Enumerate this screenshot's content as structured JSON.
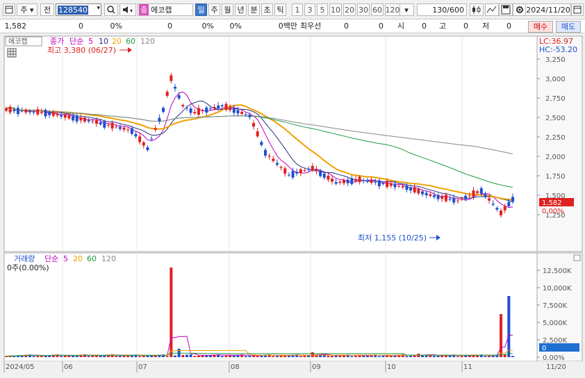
{
  "toolbar": {
    "market_label": "주",
    "prev_label": "전",
    "stock_code": "128540",
    "stock_name": "에코캡",
    "stock_badge": "종",
    "period_tabs": [
      "일",
      "주",
      "월",
      "년",
      "분",
      "초",
      "틱"
    ],
    "selected_period": "일",
    "interval_tabs": [
      "1",
      "3",
      "5",
      "10",
      "20",
      "30",
      "60",
      "120"
    ],
    "count": "130",
    "count_total": "/600",
    "date": "2024/11/20"
  },
  "infobar": {
    "price": "1,582",
    "change": "0",
    "change_pct": "0%",
    "volume": "0",
    "volume_pct": "0%",
    "vol_rate": "0%",
    "amount": "0백만",
    "priority_label": "최우선",
    "priority_value": "0",
    "priority_value2": "0",
    "open_label": "시",
    "open_value": "0",
    "high_label": "고",
    "high_value": "0",
    "low_label": "저",
    "low_value": "0",
    "buy_label": "매수",
    "sell_label": "매도"
  },
  "price_panel": {
    "stock_tag": "에코캡",
    "legend_close": "종가",
    "legend_ma_label": "단순",
    "legend_ma": [
      "5",
      "10",
      "20",
      "60",
      "120"
    ],
    "high_note": "최고 3,380 (06/27)",
    "low_note": "최저 1,155 (10/25)",
    "lc": "LC:36.97",
    "hc": "HC:-53.20",
    "current_price": "1,582",
    "current_pct": "0.00%",
    "y_ticks": [
      "3,250",
      "3,000",
      "2,750",
      "2,500",
      "2,250",
      "2,000",
      "1,750",
      "1,500",
      "1,250"
    ]
  },
  "volume_panel": {
    "title": "거래량",
    "ma_label": "단순",
    "ma": [
      "5",
      "20",
      "60",
      "120"
    ],
    "sub": "0주(0.00%)",
    "y_ticks": [
      "12,500K",
      "10,000K",
      "7,500K",
      "5,000K",
      "2,500K",
      "0.00%"
    ],
    "current": "0"
  },
  "x_axis": {
    "labels": [
      "2024/05",
      "06",
      "07",
      "08",
      "09",
      "10",
      "11"
    ],
    "right_label": "11/20"
  },
  "colors": {
    "up": "#e02020",
    "down": "#1d4fd0",
    "ma5": "#c000c0",
    "ma10": "#203080",
    "ma20": "#f0a000",
    "ma60": "#1a9a40",
    "ma120": "#888888"
  }
}
